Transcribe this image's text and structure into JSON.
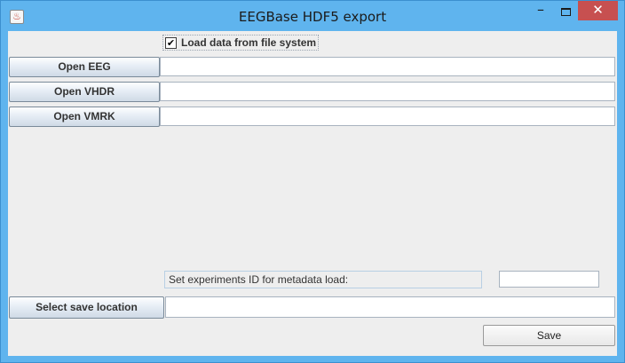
{
  "window": {
    "title": "EEGBase HDF5 export",
    "app_icon_glyph": "♨",
    "minimize_glyph": "–",
    "close_glyph": "✕"
  },
  "form": {
    "load_checkbox": {
      "label": "Load data from file system",
      "checked": true,
      "glyph": "✔"
    },
    "open_eeg": {
      "label": "Open EEG",
      "value": ""
    },
    "open_vhdr": {
      "label": "Open VHDR",
      "value": ""
    },
    "open_vmrk": {
      "label": "Open VMRK",
      "value": ""
    },
    "experiment_id": {
      "label": "Set experiments ID for metadata load:",
      "value": ""
    },
    "save_location": {
      "label": "Select save location",
      "value": ""
    },
    "save_button": {
      "label": "Save"
    }
  },
  "colors": {
    "titlebar": "#5fb4ee",
    "close_button": "#c75050",
    "panel_background": "#eeeeee"
  }
}
